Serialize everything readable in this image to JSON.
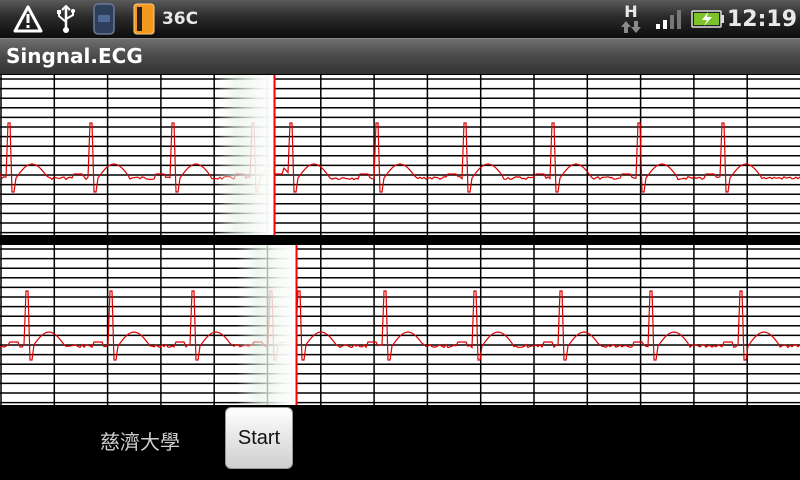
{
  "status_bar": {
    "temperature": "36C",
    "network_type": "H",
    "time": "12:19",
    "icons": [
      "warning-icon",
      "usb-icon",
      "phone-app-icon",
      "battery-app-icon",
      "data-transfer-icon",
      "signal-icon",
      "battery-charging-icon"
    ]
  },
  "app": {
    "title": "Singnal.ECG"
  },
  "bottom": {
    "label": "慈濟大學",
    "start_label": "Start"
  },
  "colors": {
    "trace": "#dd0000",
    "sweep_line": "#ff0000",
    "grid": "#000000",
    "background": "#ffffff"
  }
}
